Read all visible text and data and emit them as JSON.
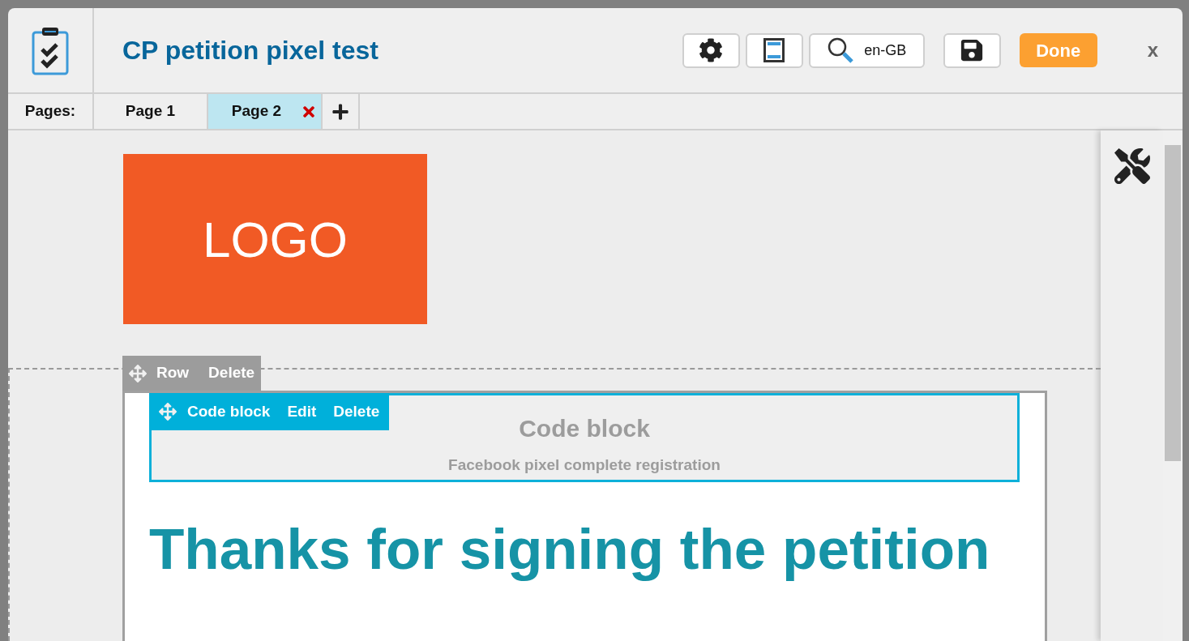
{
  "window": {
    "title": "CP petition pixel test",
    "close": "x"
  },
  "toolbar": [
    {
      "kind": "settings"
    },
    {
      "kind": "layout"
    },
    {
      "kind": "language",
      "label": "en-GB"
    },
    {
      "kind": "save"
    },
    {
      "kind": "done",
      "label": "Done"
    }
  ],
  "pages": {
    "label": "Pages:",
    "tabs": [
      {
        "label": "Page 1",
        "selected": false
      },
      {
        "label": "Page 2",
        "selected": true
      }
    ]
  },
  "canvas": {
    "logo": "LOGO",
    "row_toolbar": [
      "Row",
      "Delete"
    ],
    "code_block": {
      "toolbar": [
        "Code block",
        "Edit",
        "Delete"
      ],
      "title": "Code block",
      "description": "Facebook pixel complete registration"
    },
    "heading": "Thanks for signing the petition"
  }
}
